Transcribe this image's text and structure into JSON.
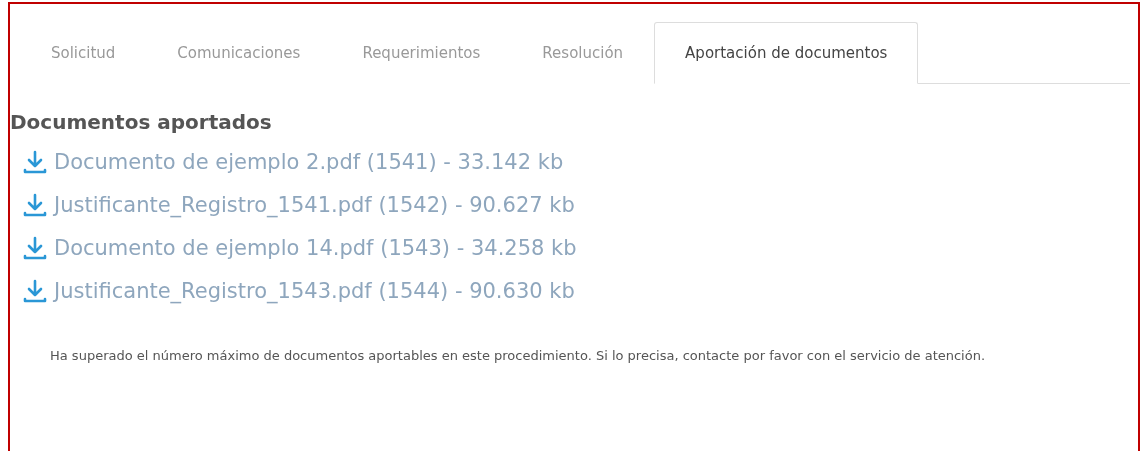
{
  "tabs": [
    {
      "label": "Solicitud",
      "selected": false
    },
    {
      "label": "Comunicaciones",
      "selected": false
    },
    {
      "label": "Requerimientos",
      "selected": false
    },
    {
      "label": "Resolución",
      "selected": false
    },
    {
      "label": "Aportación de documentos",
      "selected": true
    }
  ],
  "section": {
    "title": "Documentos aportados",
    "documents": [
      {
        "label": "Documento de ejemplo 2.pdf (1541) - 33.142 kb"
      },
      {
        "label": "Justificante_Registro_1541.pdf (1542) - 90.627 kb"
      },
      {
        "label": "Documento de ejemplo 14.pdf (1543) - 34.258 kb"
      },
      {
        "label": "Justificante_Registro_1543.pdf (1544) - 90.630 kb"
      }
    ],
    "message": "Ha superado el número máximo de documentos aportables en este procedimiento. Si lo precisa, contacte por favor con el servicio de atención."
  }
}
